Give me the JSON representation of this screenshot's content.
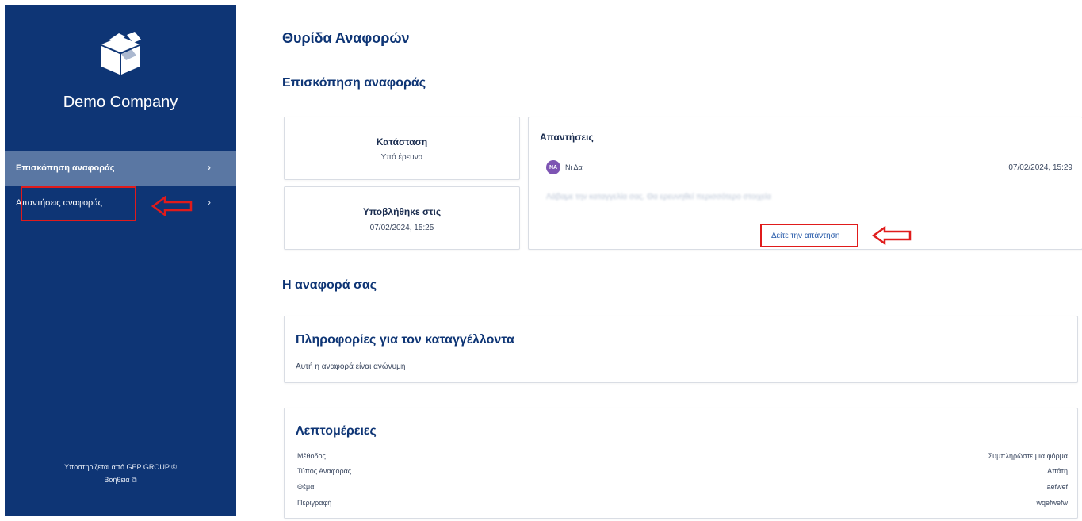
{
  "sidebar": {
    "company": "Demo Company",
    "items": [
      {
        "label": "Επισκόπηση αναφοράς"
      },
      {
        "label": "Απαντήσεις αναφοράς"
      }
    ],
    "footer_powered": "Υποστηρίζεται από GEP GROUP",
    "footer_help": "Βοήθεια"
  },
  "main": {
    "title": "Θυρίδα Αναφορών",
    "overview_title": "Επισκόπηση αναφοράς",
    "status": {
      "label": "Κατάσταση",
      "value": "Υπό έρευνα"
    },
    "submitted": {
      "label": "Υποβλήθηκε στις",
      "value": "07/02/2024, 15:25"
    },
    "replies": {
      "title": "Απαντήσεις",
      "avatar_initials": "ΝΑ",
      "author": "Νι     Δα",
      "date": "07/02/2024, 15:29",
      "preview": "Λάβαμε την καταγγελία σας. Θα ερευνηθεί περισσότερο στοιχεία",
      "link": "Δείτε την απάντηση"
    },
    "your_report_title": "Η αναφορά σας",
    "reporter": {
      "title": "Πληροφορίες για τον καταγγέλλοντα",
      "text": "Αυτή η αναφορά είναι ανώνυμη"
    },
    "details": {
      "title": "Λεπτομέρειες",
      "rows": [
        {
          "key": "Μέθοδος",
          "value": "Συμπληρώστε μια φόρμα"
        },
        {
          "key": "Τύπος Αναφοράς",
          "value": "Απάτη"
        },
        {
          "key": "Θέμα",
          "value": "aefwef"
        },
        {
          "key": "Περιγραφή",
          "value": "wqefwefw"
        }
      ]
    }
  },
  "colors": {
    "sidebar": "#0e3575",
    "active": "#5a77a3",
    "annotation": "#e01b1b",
    "link": "#2458a8"
  },
  "icons": [
    "box-logo-icon",
    "chevron-right-icon",
    "copyright-icon",
    "external-link-icon",
    "arrow-left-annotation-icon"
  ]
}
